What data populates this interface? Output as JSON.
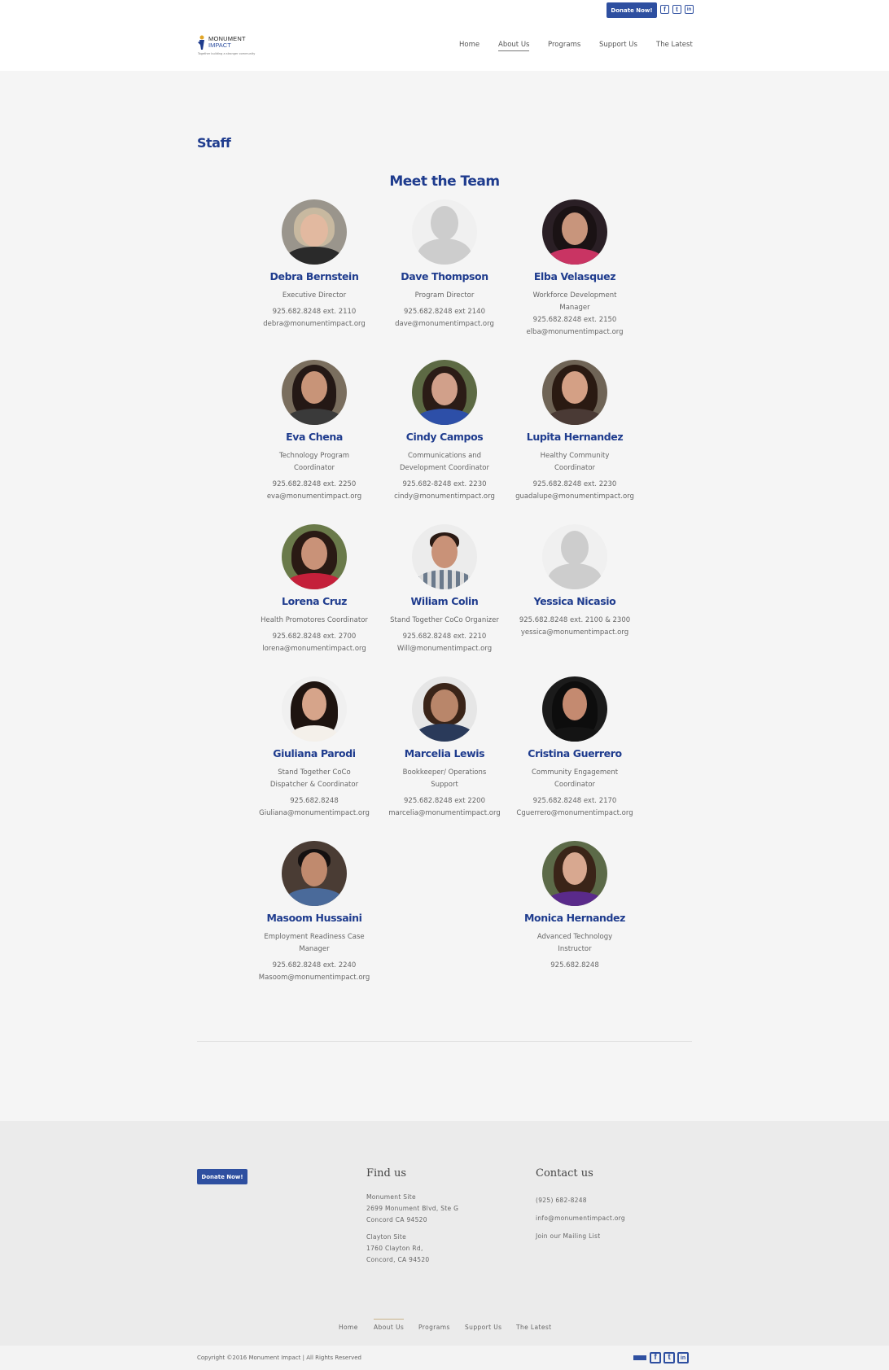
{
  "header": {
    "donate_label": "Donate Now!",
    "logo_line1": "MONUMENT",
    "logo_line2": "IMPACT",
    "logo_tagline": "Together building a stronger community",
    "nav": [
      {
        "label": "Home"
      },
      {
        "label": "About Us"
      },
      {
        "label": "Programs"
      },
      {
        "label": "Support Us"
      },
      {
        "label": "The Latest"
      }
    ]
  },
  "page": {
    "title": "Staff",
    "section_title": "Meet the Team"
  },
  "staff": [
    {
      "name": "Debra Bernstein",
      "role": "Executive Director",
      "phone": "925.682.8248 ext. 2110",
      "email": "debra@monumentimpact.org"
    },
    {
      "name": "Dave Thompson",
      "role": "Program Director",
      "phone": "925.682.8248 ext 2140",
      "email": "dave@monumentimpact.org"
    },
    {
      "name": "Elba Velasquez",
      "role": "Workforce Development Manager",
      "phone": "925.682.8248 ext. 2150",
      "email": "elba@monumentimpact.org"
    },
    {
      "name": "Eva Chena",
      "role": "Technology Program Coordinator",
      "phone": "925.682.8248 ext. 2250",
      "email": "eva@monumentimpact.org"
    },
    {
      "name": "Cindy Campos",
      "role": "Communications and Development Coordinator",
      "phone": "925.682-8248 ext. 2230",
      "email": "cindy@monumentimpact.org"
    },
    {
      "name": "Lupita Hernandez",
      "role": "Healthy Community Coordinator",
      "phone": "925.682.8248 ext. 2230",
      "email": "guadalupe@monumentimpact.org"
    },
    {
      "name": "Lorena Cruz",
      "role": "Health Promotores Coordinator",
      "phone": "925.682.8248 ext. 2700",
      "email": "lorena@monumentimpact.org"
    },
    {
      "name": "Wiliam Colin",
      "role": "Stand Together CoCo Organizer",
      "phone": "925.682.8248 ext. 2210",
      "email": "Will@monumentimpact.org"
    },
    {
      "name": "Yessica Nicasio",
      "role": "",
      "phone": "925.682.8248 ext. 2100 & 2300",
      "email": "yessica@monumentimpact.org"
    },
    {
      "name": "Giuliana Parodi",
      "role": "Stand Together CoCo Dispatcher & Coordinator",
      "phone": "925.682.8248",
      "email": "Giuliana@monumentimpact.org"
    },
    {
      "name": "Marcelia Lewis",
      "role": "Bookkeeper/ Operations Support",
      "phone": "925.682.8248 ext 2200",
      "email": "marcelia@monumentimpact.org"
    },
    {
      "name": "Cristina Guerrero",
      "role": "Community Engagement Coordinator",
      "phone": "925.682.8248 ext. 2170",
      "email": "Cguerrero@monumentimpact.org"
    },
    {
      "name": "Masoom Hussaini",
      "role": "Employment Readiness Case Manager",
      "phone": "925.682.8248 ext. 2240",
      "email": "Masoom@monumentimpact.org"
    },
    {
      "name": "Monica Hernandez",
      "role": "Advanced Technology Instructor",
      "phone": "925.682.8248",
      "email": ""
    }
  ],
  "footer": {
    "donate_label": "Donate Now!",
    "find_us": {
      "heading": "Find us",
      "site1_name": "Monument Site",
      "site1_addr1": "2699 Monument Blvd, Ste G",
      "site1_addr2": "Concord CA 94520",
      "site2_name": "Clayton Site",
      "site2_addr1": "1760 Clayton Rd,",
      "site2_addr2": "Concord, CA 94520"
    },
    "contact": {
      "heading": "Contact us",
      "phone": "(925) 682-8248",
      "email": "info@monumentimpact.org",
      "mailing": "Join our Mailing List"
    },
    "nav": [
      {
        "label": "Home"
      },
      {
        "label": "About Us"
      },
      {
        "label": "Programs"
      },
      {
        "label": "Support Us"
      },
      {
        "label": "The Latest"
      }
    ],
    "copyright": "Copyright ©2016 Monument Impact | All Rights Reserved"
  },
  "icons": {
    "facebook": "f",
    "tumblr": "t",
    "linkedin": "in"
  },
  "colors": {
    "brand_blue": "#1f3c8e",
    "button_blue": "#2e4fa0"
  }
}
